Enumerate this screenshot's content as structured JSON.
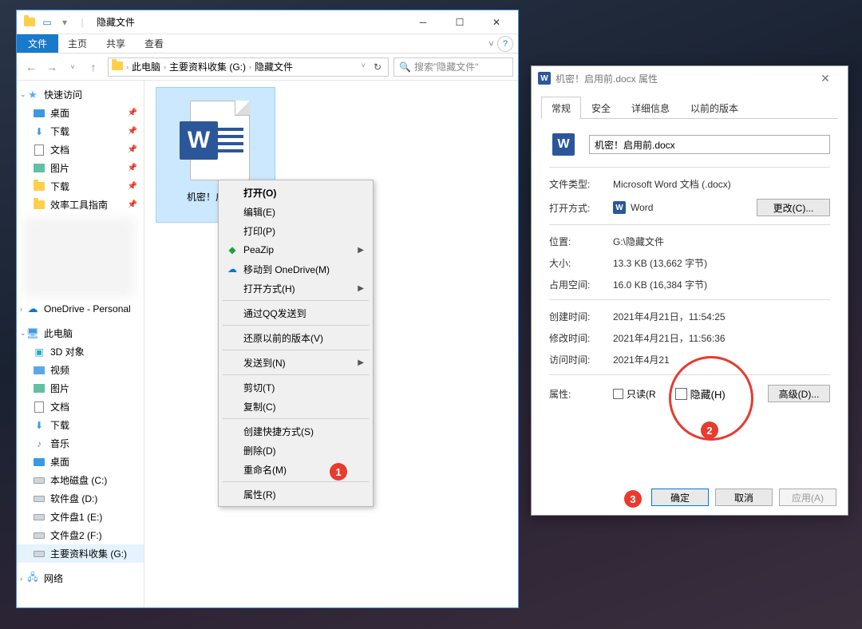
{
  "explorer": {
    "title": "隐藏文件",
    "ribbon": {
      "file": "文件",
      "home": "主页",
      "share": "共享",
      "view": "查看"
    },
    "breadcrumb": [
      "此电脑",
      "主要资料收集 (G:)",
      "隐藏文件"
    ],
    "search_placeholder": "搜索\"隐藏文件\"",
    "file": {
      "name": "机密！启用…"
    },
    "nav": {
      "quick": "快速访问",
      "desktop": "桌面",
      "downloads": "下载",
      "documents": "文档",
      "pictures": "图片",
      "downloads2": "下载",
      "efficiency": "效率工具指南",
      "onedrive": "OneDrive - Personal",
      "thispc": "此电脑",
      "obj3d": "3D 对象",
      "videos": "视频",
      "pictures2": "图片",
      "documents2": "文档",
      "downloads3": "下载",
      "music": "音乐",
      "desktop2": "桌面",
      "cdrive": "本地磁盘 (C:)",
      "ddrive": "软件盘 (D:)",
      "edrive": "文件盘1 (E:)",
      "fdrive": "文件盘2 (F:)",
      "gdrive": "主要资料收集 (G:)",
      "network": "网络"
    }
  },
  "context_menu": {
    "open": "打开(O)",
    "edit": "编辑(E)",
    "print": "打印(P)",
    "peazip": "PeaZip",
    "move_onedrive": "移动到 OneDrive(M)",
    "open_with": "打开方式(H)",
    "qq_send": "通过QQ发送到",
    "restore": "还原以前的版本(V)",
    "send_to": "发送到(N)",
    "cut": "剪切(T)",
    "copy": "复制(C)",
    "shortcut": "创建快捷方式(S)",
    "delete": "删除(D)",
    "rename": "重命名(M)",
    "properties": "属性(R)"
  },
  "props": {
    "title": "机密！启用前.docx 属性",
    "tabs": {
      "general": "常规",
      "security": "安全",
      "details": "详细信息",
      "previous": "以前的版本"
    },
    "filename": "机密！启用前.docx",
    "rows": {
      "type_l": "文件类型:",
      "type_v": "Microsoft Word 文档 (.docx)",
      "open_l": "打开方式:",
      "open_v": "Word",
      "change": "更改(C)...",
      "loc_l": "位置:",
      "loc_v": "G:\\隐藏文件",
      "size_l": "大小:",
      "size_v": "13.3 KB (13,662 字节)",
      "disk_l": "占用空间:",
      "disk_v": "16.0 KB (16,384 字节)",
      "ctime_l": "创建时间:",
      "ctime_v": "2021年4月21日，11:54:25",
      "mtime_l": "修改时间:",
      "mtime_v": "2021年4月21日，11:56:36",
      "atime_l": "访问时间:",
      "atime_v": "2021年4月21",
      "attr_l": "属性:",
      "readonly": "只读(R",
      "hidden": "隐藏(H)",
      "advanced": "高级(D)..."
    },
    "footer": {
      "ok": "确定",
      "cancel": "取消",
      "apply": "应用(A)"
    }
  },
  "anno": {
    "n1": "1",
    "n2": "2",
    "n3": "3"
  }
}
